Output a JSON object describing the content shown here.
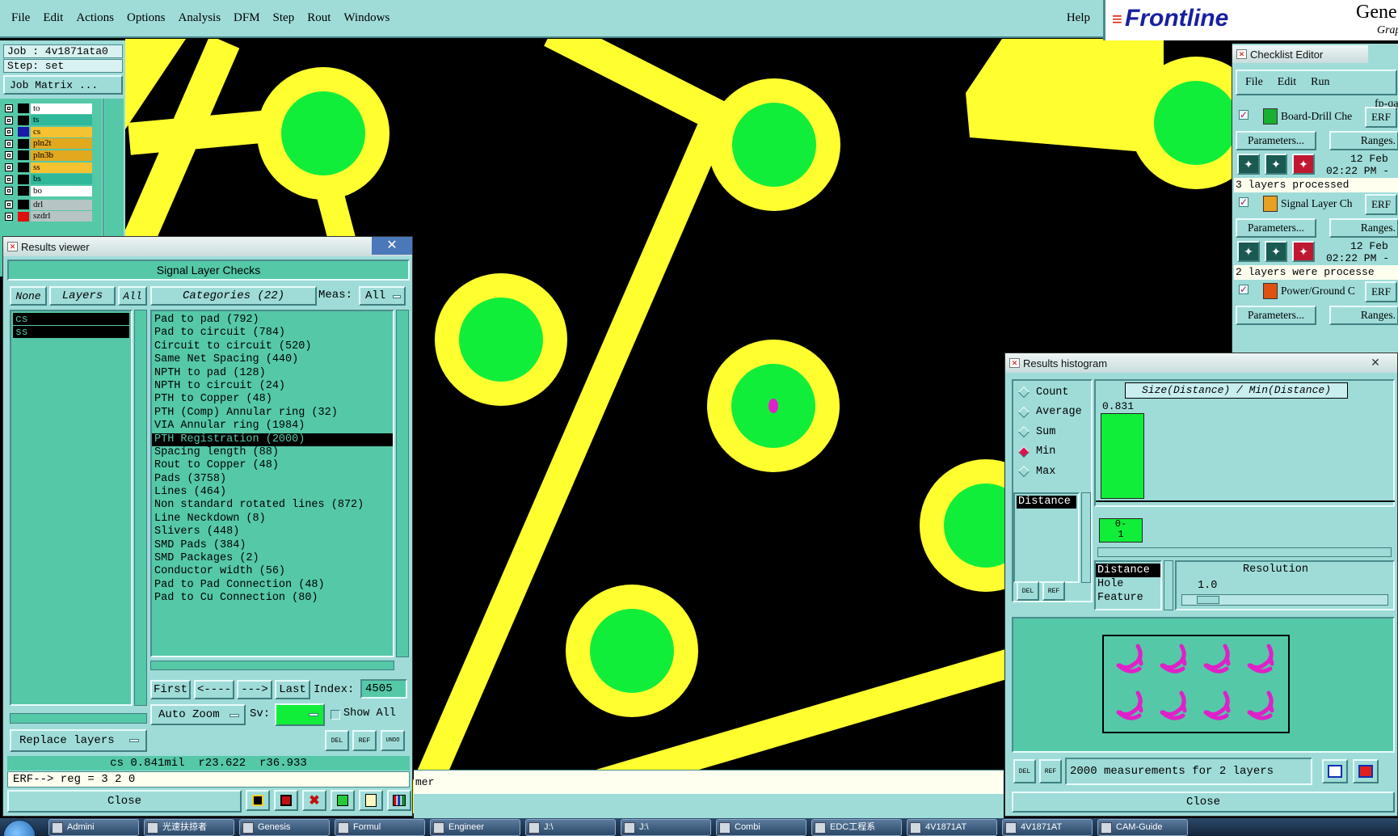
{
  "menu": {
    "items": [
      "File",
      "Edit",
      "Actions",
      "Options",
      "Analysis",
      "DFM",
      "Step",
      "Rout",
      "Windows"
    ],
    "help": "Help"
  },
  "logo": {
    "brand": "Frontline",
    "suffix": "Gene",
    "sub": "Grap"
  },
  "job": {
    "job": "Job : 4v1871ata0",
    "step": "Step: set",
    "matrix_button": "Job Matrix ..."
  },
  "layers": [
    {
      "name": "to",
      "color": "#ffffff",
      "swatch": "#000000",
      "active": false
    },
    {
      "name": "ts",
      "color": "#2fb89a",
      "swatch": "#000000",
      "active": false
    },
    {
      "name": "cs",
      "color": "#f5c232",
      "swatch": "#1a1aa8",
      "active": true
    },
    {
      "name": "pln2t",
      "color": "#e2a81e",
      "swatch": "#000000",
      "active": false
    },
    {
      "name": "pln3b",
      "color": "#e2a81e",
      "swatch": "#000000",
      "active": false
    },
    {
      "name": "ss",
      "color": "#f5c232",
      "swatch": "#000000",
      "active": false
    },
    {
      "name": "bs",
      "color": "#2fb89a",
      "swatch": "#000000",
      "active": false
    },
    {
      "name": "bo",
      "color": "#ffffff",
      "swatch": "#000000",
      "active": false
    }
  ],
  "drill_layers": [
    {
      "name": "drl",
      "color": "#b6c4c4",
      "swatch": "#000000"
    },
    {
      "name": "szdrl",
      "color": "#b6c4c4",
      "swatch": "#e01010"
    }
  ],
  "results_viewer": {
    "title": "Results viewer",
    "heading": "Signal Layer Checks",
    "none_btn": "None",
    "layers_btn": "Layers",
    "all_btn": "All",
    "layer_list": [
      "cs",
      "ss"
    ],
    "categories_label": "Categories (22)",
    "meas_label": "Meas:",
    "meas_value": "All",
    "categories": [
      "Pad to pad (792)",
      "Pad to circuit (784)",
      "Circuit to circuit (520)",
      "Same Net Spacing (440)",
      "NPTH to pad (128)",
      "NPTH to circuit (24)",
      "PTH to Copper (48)",
      "PTH (Comp) Annular ring (32)",
      "VIA Annular ring (1984)",
      "PTH Registration (2000)",
      "Spacing length (88)",
      "Rout to Copper (48)",
      "Pads (3758)",
      "Lines (464)",
      "Non standard rotated lines (872)",
      "Line Neckdown (8)",
      "Slivers (448)",
      "SMD Pads (384)",
      "SMD Packages (2)",
      "Conductor width (56)",
      "Pad to Pad Connection (48)",
      "Pad to Cu Connection (80)"
    ],
    "selected_category": 9,
    "first_btn": "First",
    "prev_btn": "<----",
    "next_btn": "--->",
    "last_btn": "Last",
    "index_label": "Index:",
    "index_value": "4505",
    "zoom_value": "Auto Zoom",
    "sv_label": "Sv:",
    "show_all_label": "Show All",
    "replace_layers": "Replace layers",
    "status": "cs 0.841mil  r23.622  r36.933",
    "erf_line": "ERF--> reg = 3 2 0",
    "close": "Close",
    "del_label": "DEL",
    "ref_label": "REF",
    "undo_label": "UNDO"
  },
  "background_status": "mer",
  "checklist": {
    "title": "Checklist Editor",
    "menu": [
      "File",
      "Edit",
      "Run"
    ],
    "name": "fp-qa",
    "erf": "ERF",
    "params": "Parameters...",
    "ranges": "Ranges.",
    "checks": [
      {
        "name": "Board-Drill Che",
        "date": "12 Feb",
        "time": "02:22 PM -",
        "note": "3 layers processed"
      },
      {
        "name": "Signal Layer Ch",
        "date": "12 Feb",
        "time": "02:22 PM -",
        "note": "2 layers were processe"
      },
      {
        "name": "Power/Ground C",
        "date": "",
        "time": "",
        "note": ""
      }
    ]
  },
  "histogram": {
    "title": "Results histogram",
    "options": [
      "Count",
      "Average",
      "Sum",
      "Min",
      "Max"
    ],
    "selected_option": "Min",
    "measure_list": [
      "Distance"
    ],
    "chart_title": "Size(Distance) / Min(Distance)",
    "bar_value": "0.831",
    "bin_label_top": "0-",
    "bin_label_bottom": "1",
    "sort_list": [
      "Distance",
      "Hole",
      "Feature"
    ],
    "resolution_label": "Resolution",
    "resolution_value": "1.0",
    "summary": "2000 measurements for 2 layers",
    "close": "Close"
  },
  "taskbar": {
    "items": [
      "Admini",
      "光速扶掠者",
      "Genesis",
      "Formul",
      "Engineer",
      "J:\\",
      "J:\\",
      "Combi",
      "EDC工程系",
      "4V1871AT",
      "4V1871AT",
      "CAM-Guide"
    ]
  }
}
